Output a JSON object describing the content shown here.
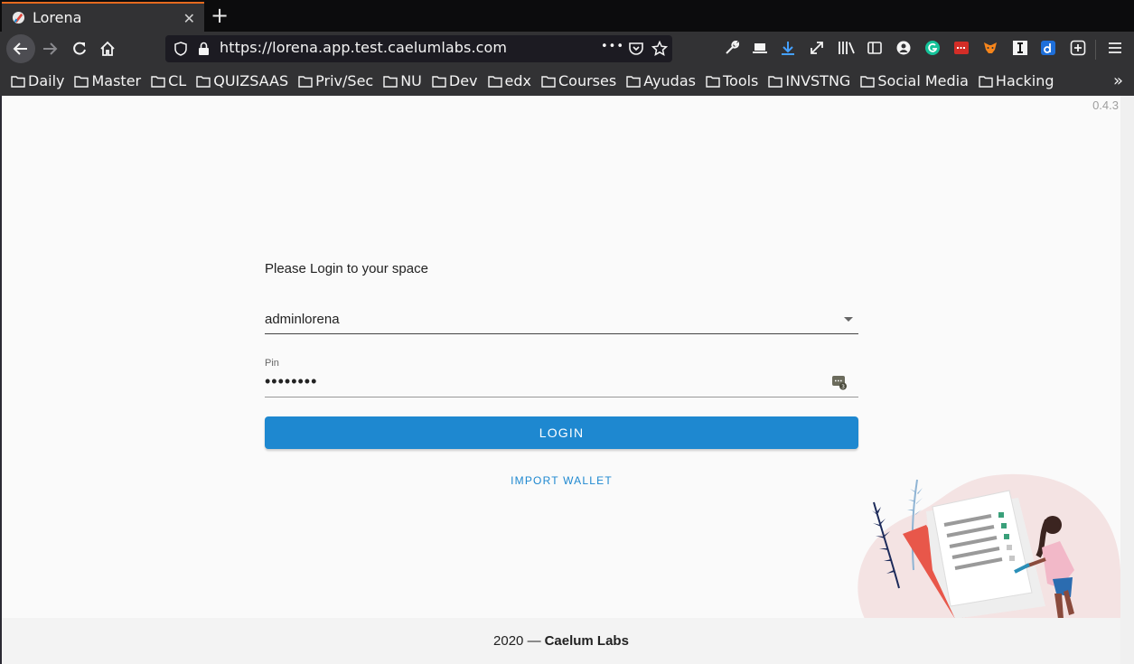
{
  "browser": {
    "tab": {
      "title": "Lorena",
      "close": "✕"
    },
    "new_tab": "+",
    "url": "https://lorena.app.test.caelumlabs.com",
    "url_actions": "•••",
    "bookmarks": [
      "Daily",
      "Master",
      "CL",
      "QUIZSAAS",
      "Priv/Sec",
      "NU",
      "Dev",
      "edx",
      "Courses",
      "Ayudas",
      "Tools",
      "INVSTNG",
      "Social Media",
      "Hacking"
    ],
    "bookmarks_more": "»"
  },
  "page": {
    "version": "0.4.3",
    "prompt": "Please Login to your space",
    "user_select": {
      "value": "adminlorena"
    },
    "pin": {
      "label": "Pin",
      "value": "••••••••"
    },
    "login_label": "LOGIN",
    "import_label": "IMPORT WALLET",
    "footer": {
      "year_text": "2020 —",
      "company": "Caelum Labs"
    }
  },
  "colors": {
    "accent": "#1e88d0",
    "tab_accent": "#e66a1e",
    "chrome_bg": "#323234"
  }
}
